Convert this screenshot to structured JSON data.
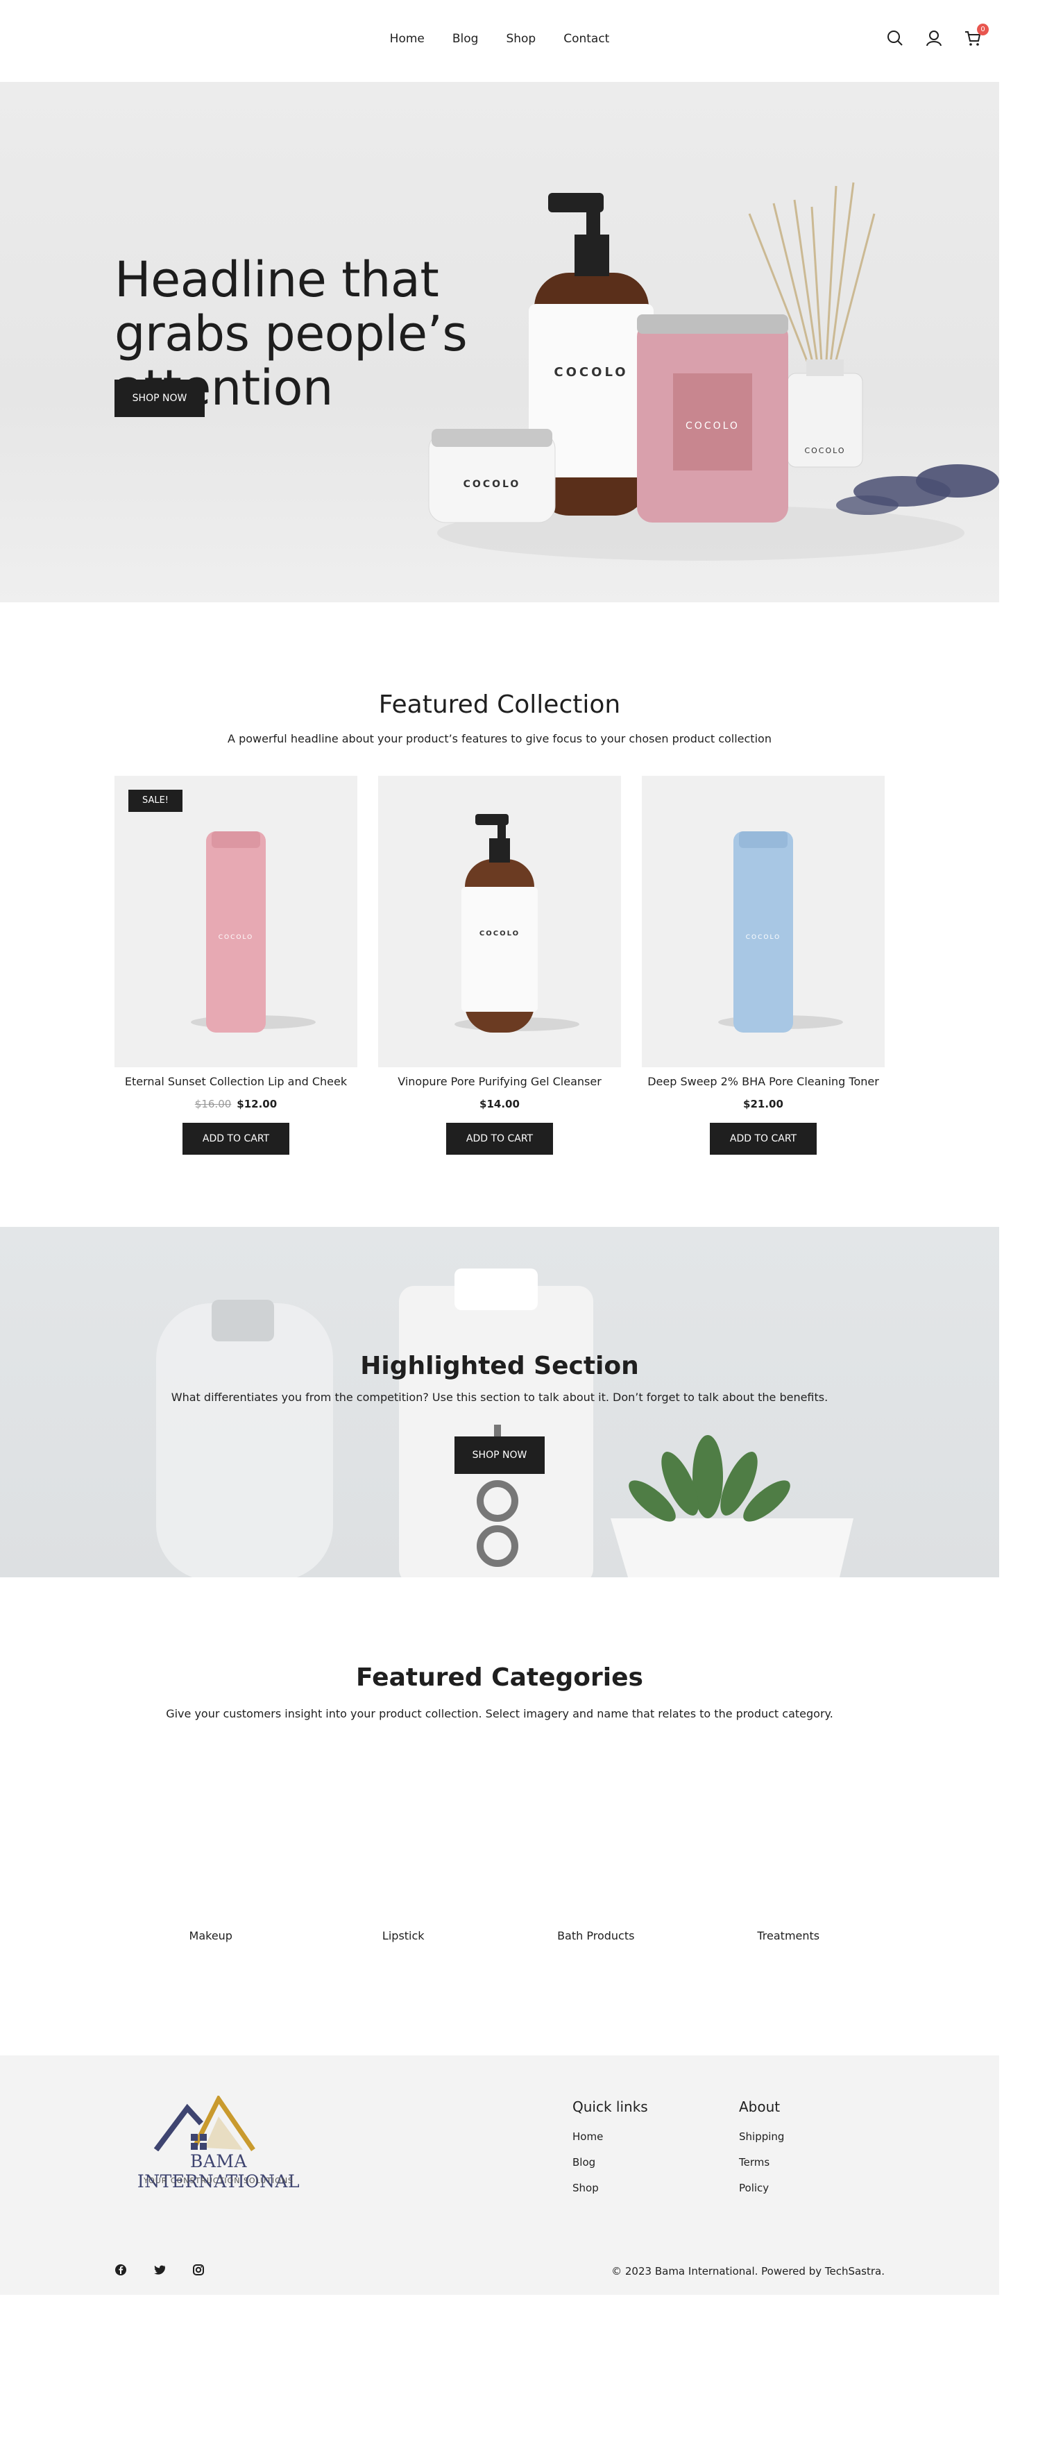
{
  "header": {
    "nav": [
      "Home",
      "Blog",
      "Shop",
      "Contact"
    ],
    "cart_count": "0",
    "icons": [
      "search-icon",
      "user-icon",
      "cart-icon"
    ]
  },
  "hero": {
    "headline": "Headline that grabs people’s attention",
    "button": "SHOP NOW",
    "brand_on_products": "COCOLO"
  },
  "featured_collection": {
    "title": "Featured Collection",
    "subtitle": "A powerful headline about your product’s features to give focus to your chosen product collection",
    "products": [
      {
        "name": "Eternal Sunset Collection Lip and Cheek",
        "old_price": "$16.00",
        "price": "$12.00",
        "badge": "SALE!",
        "button": "ADD TO CART",
        "color": "#e7a9b3"
      },
      {
        "name": "Vinopure Pore Purifying Gel Cleanser",
        "old_price": "",
        "price": "$14.00",
        "badge": "",
        "button": "ADD TO CART",
        "color": "#6b3b22"
      },
      {
        "name": "Deep Sweep 2% BHA Pore Cleaning Toner",
        "old_price": "",
        "price": "$21.00",
        "badge": "",
        "button": "ADD TO CART",
        "color": "#a8c7e4"
      }
    ]
  },
  "highlight": {
    "title": "Highlighted Section",
    "subtitle": "What differentiates you from the competition? Use this section to talk about it. Don’t forget to talk about the benefits.",
    "button": "SHOP NOW"
  },
  "categories": {
    "title": "Featured Categories",
    "subtitle": "Give your customers insight into your product collection. Select imagery and name that relates to the product category.",
    "items": [
      "Makeup",
      "Lipstick",
      "Bath Products",
      "Treatments"
    ]
  },
  "footer": {
    "logo_name": "BAMA INTERNATIONAL",
    "logo_tagline": "YOUR CONSTRUCTION SOLUTIONS",
    "quick_links_title": "Quick links",
    "quick_links": [
      "Home",
      "Blog",
      "Shop"
    ],
    "about_title": "About",
    "about_links": [
      "Shipping",
      "Terms",
      "Policy"
    ],
    "social_icons": [
      "facebook-icon",
      "twitter-icon",
      "instagram-icon"
    ],
    "copyright": "© 2023 Bama International. Powered by TechSastra."
  },
  "colors": {
    "dark": "#1f1f1f",
    "badge_red": "#e8564f",
    "logo_navy": "#3e4470",
    "logo_gold": "#c99a2e"
  }
}
